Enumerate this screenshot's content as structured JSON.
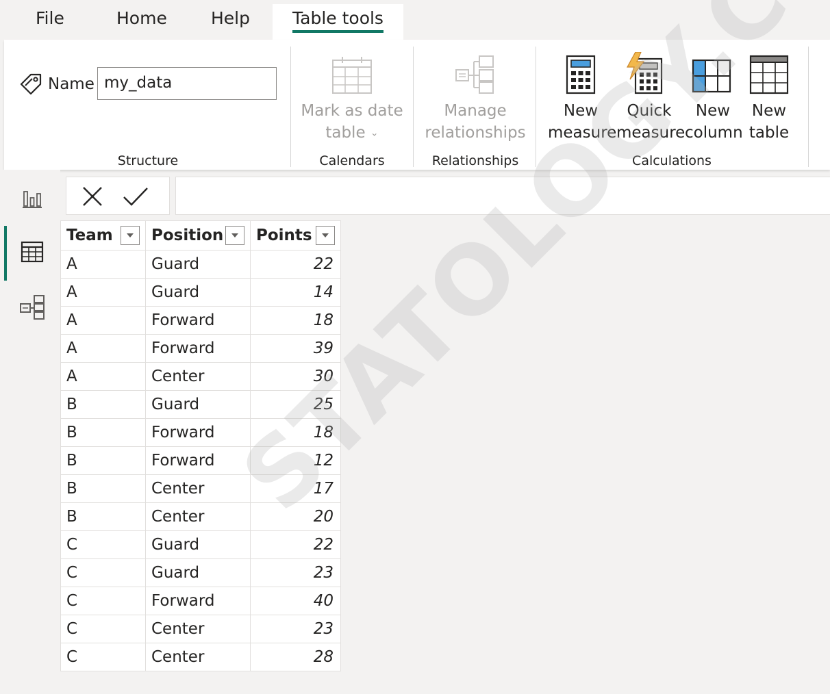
{
  "tabs": [
    {
      "label": "File"
    },
    {
      "label": "Home"
    },
    {
      "label": "Help"
    },
    {
      "label": "Table tools",
      "active": true
    }
  ],
  "ribbon": {
    "structure": {
      "name_label": "Name",
      "name_value": "my_data",
      "group_label": "Structure"
    },
    "calendars": {
      "mark_date_line1": "Mark as date",
      "mark_date_line2": "table",
      "group_label": "Calendars"
    },
    "relationships": {
      "manage_line1": "Manage",
      "manage_line2": "relationships",
      "group_label": "Relationships"
    },
    "calculations": {
      "new_measure_line1": "New",
      "new_measure_line2": "measure",
      "quick_measure_line1": "Quick",
      "quick_measure_line2": "measure",
      "new_column_line1": "New",
      "new_column_line2": "column",
      "new_table_line1": "New",
      "new_table_line2": "table",
      "group_label": "Calculations"
    }
  },
  "nav_icons": [
    "report-view-icon",
    "table-view-icon",
    "model-view-icon"
  ],
  "accent_color": "#117865",
  "table": {
    "headers": [
      "Team",
      "Position",
      "Points"
    ],
    "rows": [
      [
        "A",
        "Guard",
        "22"
      ],
      [
        "A",
        "Guard",
        "14"
      ],
      [
        "A",
        "Forward",
        "18"
      ],
      [
        "A",
        "Forward",
        "39"
      ],
      [
        "A",
        "Center",
        "30"
      ],
      [
        "B",
        "Guard",
        "25"
      ],
      [
        "B",
        "Forward",
        "18"
      ],
      [
        "B",
        "Forward",
        "12"
      ],
      [
        "B",
        "Center",
        "17"
      ],
      [
        "B",
        "Center",
        "20"
      ],
      [
        "C",
        "Guard",
        "22"
      ],
      [
        "C",
        "Guard",
        "23"
      ],
      [
        "C",
        "Forward",
        "40"
      ],
      [
        "C",
        "Center",
        "23"
      ],
      [
        "C",
        "Center",
        "28"
      ]
    ]
  },
  "watermark": "STATOLOGY.COM"
}
